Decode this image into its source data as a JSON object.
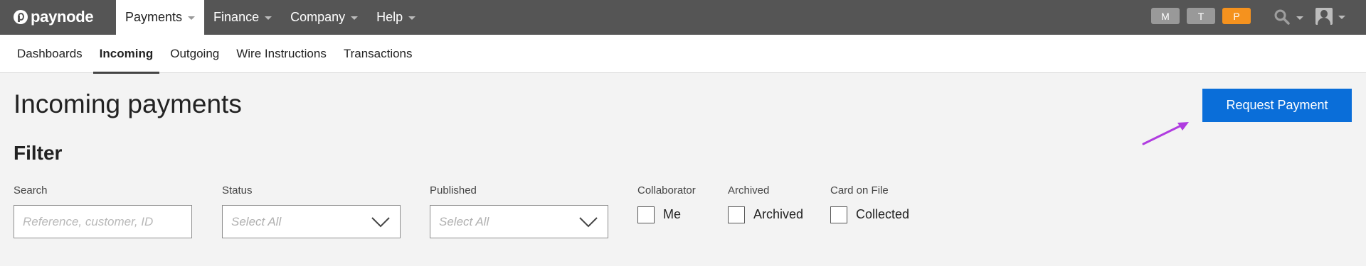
{
  "brand": {
    "name": "paynode"
  },
  "topnav": {
    "items": [
      {
        "label": "Payments",
        "active": true
      },
      {
        "label": "Finance",
        "active": false
      },
      {
        "label": "Company",
        "active": false
      },
      {
        "label": "Help",
        "active": false
      }
    ],
    "chips": [
      {
        "label": "M",
        "color": "#999999"
      },
      {
        "label": "T",
        "color": "#999999"
      },
      {
        "label": "P",
        "color": "#f5921e"
      }
    ],
    "icons": {
      "search": "search-icon",
      "user": "user-icon"
    }
  },
  "subnav": {
    "items": [
      {
        "label": "Dashboards",
        "active": false
      },
      {
        "label": "Incoming",
        "active": true
      },
      {
        "label": "Outgoing",
        "active": false
      },
      {
        "label": "Wire Instructions",
        "active": false
      },
      {
        "label": "Transactions",
        "active": false
      }
    ]
  },
  "page": {
    "title": "Incoming payments",
    "request_button": "Request Payment",
    "accent_color": "#0a6ed9",
    "annotation_arrow_color": "#b03ce0"
  },
  "filter": {
    "title": "Filter",
    "search": {
      "label": "Search",
      "placeholder": "Reference, customer, ID",
      "value": ""
    },
    "status": {
      "label": "Status",
      "value": "Select All"
    },
    "published": {
      "label": "Published",
      "value": "Select All"
    },
    "collaborator": {
      "label": "Collaborator",
      "option": "Me",
      "checked": false
    },
    "archived": {
      "label": "Archived",
      "option": "Archived",
      "checked": false
    },
    "card_on_file": {
      "label": "Card on File",
      "option": "Collected",
      "checked": false
    }
  }
}
